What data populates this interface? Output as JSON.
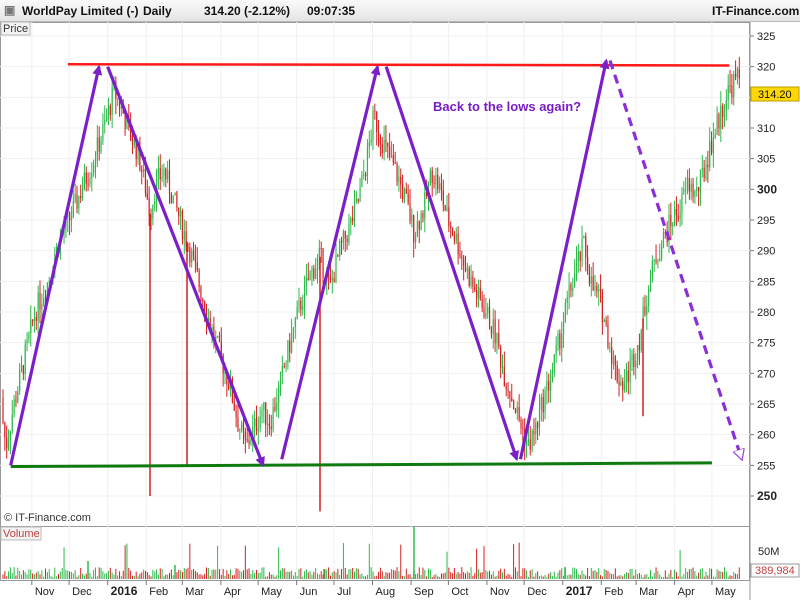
{
  "header": {
    "name": "WorldPay Limited (-)",
    "period": "Daily",
    "quote": "314.20 (-2.12%)",
    "time": "09:07:35",
    "brand": "IT-Finance.com"
  },
  "price_panel": {
    "label": "Price",
    "last_value": "314.20",
    "copyright": "© IT-Finance.com"
  },
  "volume_panel": {
    "label": "Volume",
    "axis_label": "50M",
    "last_value": "389,984"
  },
  "annotation": "Back to the lows again?",
  "colors": {
    "up": "#2db84a",
    "down": "#d42020",
    "resistance": "#ff1a1a",
    "support": "#0f7a0f",
    "arrows": "#7b1fc8",
    "price_tag": "#ffd700"
  },
  "chart_data": {
    "type": "candlestick",
    "y_ticks": [
      "325",
      "320",
      "315",
      "310",
      "305",
      "300",
      "295",
      "290",
      "285",
      "280",
      "275",
      "270",
      "265",
      "260",
      "255",
      "250"
    ],
    "ylim": [
      247,
      327
    ],
    "x_ticks": [
      {
        "label": "Nov",
        "bold": false
      },
      {
        "label": "Dec",
        "bold": false
      },
      {
        "label": "2016",
        "bold": true
      },
      {
        "label": "Feb",
        "bold": false
      },
      {
        "label": "Mar",
        "bold": false
      },
      {
        "label": "Apr",
        "bold": false
      },
      {
        "label": "May",
        "bold": false
      },
      {
        "label": "Jun",
        "bold": false
      },
      {
        "label": "Jul",
        "bold": false
      },
      {
        "label": "Aug",
        "bold": false
      },
      {
        "label": "Sep",
        "bold": false
      },
      {
        "label": "Oct",
        "bold": false
      },
      {
        "label": "Nov",
        "bold": false
      },
      {
        "label": "Dec",
        "bold": false
      },
      {
        "label": "2017",
        "bold": true
      },
      {
        "label": "Feb",
        "bold": false
      },
      {
        "label": "Mar",
        "bold": false
      },
      {
        "label": "Apr",
        "bold": false
      },
      {
        "label": "May",
        "bold": false
      }
    ],
    "price_path": [
      [
        0,
        266
      ],
      [
        6,
        258
      ],
      [
        14,
        265
      ],
      [
        24,
        272
      ],
      [
        35,
        280
      ],
      [
        48,
        285
      ],
      [
        60,
        292
      ],
      [
        72,
        296
      ],
      [
        84,
        301
      ],
      [
        94,
        305
      ],
      [
        104,
        310
      ],
      [
        114,
        316
      ],
      [
        122,
        313
      ],
      [
        130,
        309
      ],
      [
        138,
        306
      ],
      [
        146,
        300
      ],
      [
        150,
        296
      ],
      [
        156,
        301
      ],
      [
        164,
        303
      ],
      [
        172,
        299
      ],
      [
        180,
        295
      ],
      [
        190,
        290
      ],
      [
        200,
        284
      ],
      [
        210,
        278
      ],
      [
        220,
        273
      ],
      [
        230,
        268
      ],
      [
        238,
        262
      ],
      [
        246,
        258
      ],
      [
        254,
        261
      ],
      [
        262,
        264
      ],
      [
        270,
        262
      ],
      [
        280,
        268
      ],
      [
        290,
        275
      ],
      [
        300,
        281
      ],
      [
        310,
        286
      ],
      [
        320,
        289
      ],
      [
        330,
        284
      ],
      [
        340,
        290
      ],
      [
        350,
        294
      ],
      [
        358,
        298
      ],
      [
        366,
        304
      ],
      [
        374,
        312
      ],
      [
        382,
        308
      ],
      [
        390,
        305
      ],
      [
        398,
        302
      ],
      [
        406,
        298
      ],
      [
        414,
        293
      ],
      [
        424,
        297
      ],
      [
        432,
        303
      ],
      [
        440,
        300
      ],
      [
        448,
        295
      ],
      [
        456,
        292
      ],
      [
        466,
        287
      ],
      [
        476,
        283
      ],
      [
        486,
        280
      ],
      [
        496,
        276
      ],
      [
        504,
        270
      ],
      [
        512,
        266
      ],
      [
        520,
        262
      ],
      [
        528,
        258
      ],
      [
        536,
        261
      ],
      [
        544,
        266
      ],
      [
        552,
        270
      ],
      [
        560,
        276
      ],
      [
        568,
        282
      ],
      [
        576,
        287
      ],
      [
        584,
        291
      ],
      [
        592,
        284
      ],
      [
        600,
        282
      ],
      [
        608,
        276
      ],
      [
        616,
        270
      ],
      [
        624,
        268
      ],
      [
        632,
        272
      ],
      [
        640,
        276
      ],
      [
        648,
        284
      ],
      [
        656,
        289
      ],
      [
        664,
        292
      ],
      [
        672,
        295
      ],
      [
        680,
        297
      ],
      [
        688,
        301
      ],
      [
        696,
        299
      ],
      [
        704,
        303
      ],
      [
        712,
        308
      ],
      [
        720,
        312
      ],
      [
        728,
        316
      ],
      [
        736,
        318
      ]
    ],
    "resistance": {
      "start": [
        "2015-11-30",
        320.4
      ],
      "end": [
        "2017-05-15",
        320.2
      ]
    },
    "support": {
      "start": [
        "2015-10-15",
        254.8
      ],
      "end": [
        "2017-05-01",
        255.4
      ]
    },
    "arrows": [
      {
        "from": [
          "2015-10-15",
          255
        ],
        "to": [
          "2015-12-25",
          320
        ]
      },
      {
        "from": [
          "2016-01-01",
          320
        ],
        "to": [
          "2016-05-05",
          255
        ]
      },
      {
        "from": [
          "2016-05-20",
          256
        ],
        "to": [
          "2016-08-05",
          320
        ]
      },
      {
        "from": [
          "2016-08-12",
          320
        ],
        "to": [
          "2016-11-25",
          256
        ]
      },
      {
        "from": [
          "2016-11-28",
          256
        ],
        "to": [
          "2017-02-05",
          321
        ]
      }
    ],
    "projection": {
      "from": [
        "2017-02-08",
        321
      ],
      "to": [
        "2017-05-25",
        256
      ],
      "dashed": true
    }
  }
}
